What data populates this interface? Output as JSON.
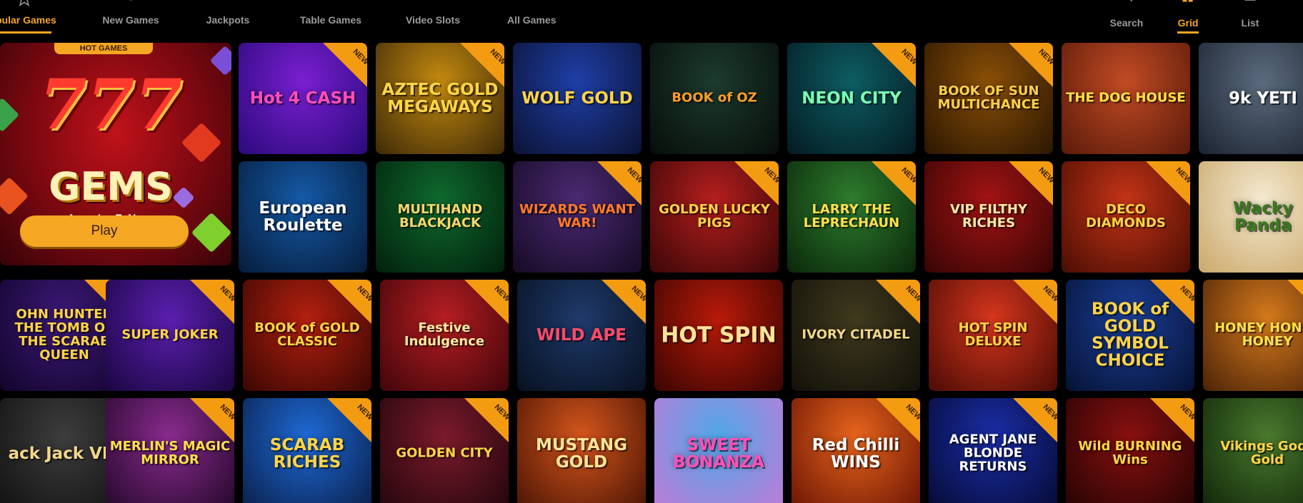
{
  "nav": {
    "tabs": [
      {
        "label": "pular Games",
        "icon": "star-icon",
        "active": true
      },
      {
        "label": "New Games",
        "icon": "chevron-down-icon",
        "active": false
      },
      {
        "label": "Jackpots",
        "icon": "jackpot-icon",
        "active": false
      },
      {
        "label": "Table Games",
        "icon": "cards-icon",
        "active": false
      },
      {
        "label": "Video Slots",
        "icon": "slot-icon",
        "active": false
      },
      {
        "label": "All Games",
        "icon": "grid-icon",
        "active": false
      }
    ],
    "view": {
      "search_label": "Search",
      "grid_label": "Grid",
      "list_label": "List",
      "active": "Grid"
    }
  },
  "hero": {
    "badge": "HOT GAMES",
    "logo_777": "777",
    "logo_gems": "GEMS",
    "subtitle": "· classic 5 lines ·",
    "play_label": "Play"
  },
  "new_badge": "NEW",
  "games": [
    {
      "name": "Hot 4 Cash",
      "new": true
    },
    {
      "name": "Aztec Gold Megaways",
      "new": true
    },
    {
      "name": "Wolf Gold",
      "new": false
    },
    {
      "name": "Book of Oz",
      "new": false
    },
    {
      "name": "Neon City",
      "new": true
    },
    {
      "name": "Book of Sun Multichance",
      "new": true
    },
    {
      "name": "The Dog House",
      "new": false
    },
    {
      "name": "9k Yeti",
      "new": false
    },
    {
      "name": "European Roulette",
      "new": false
    },
    {
      "name": "Multihand Blackjack",
      "new": false
    },
    {
      "name": "Wizards Want War!",
      "new": true
    },
    {
      "name": "Golden Lucky Pigs",
      "new": true
    },
    {
      "name": "Larry the Leprechaun",
      "new": true
    },
    {
      "name": "VIP Filthy Riches",
      "new": true
    },
    {
      "name": "Deco Diamonds",
      "new": true
    },
    {
      "name": "Wacky Panda",
      "new": false
    },
    {
      "name": "John Hunter and the Tomb of the Scarab Queen",
      "new": true
    },
    {
      "name": "Super Joker",
      "new": true
    },
    {
      "name": "Book of Gold Classic",
      "new": true
    },
    {
      "name": "Festive Indulgence",
      "new": true
    },
    {
      "name": "Wild Ape",
      "new": true
    },
    {
      "name": "Hot Spin",
      "new": false
    },
    {
      "name": "Ivory Citadel",
      "new": true
    },
    {
      "name": "Hot Spin Deluxe",
      "new": true
    },
    {
      "name": "Book of Gold Symbol Choice",
      "new": true
    },
    {
      "name": "Honey Honey Honey",
      "new": true
    },
    {
      "name": "Black Jack VIP",
      "new": false
    },
    {
      "name": "Merlin's Magic Mirror",
      "new": true
    },
    {
      "name": "Scarab Riches",
      "new": true
    },
    {
      "name": "Golden City",
      "new": true
    },
    {
      "name": "Mustang Gold",
      "new": false
    },
    {
      "name": "Sweet Bonanza",
      "new": false
    },
    {
      "name": "Red Chilli Wins",
      "new": true
    },
    {
      "name": "Agent Jane Blonde Returns",
      "new": true
    },
    {
      "name": "Wild Burning Wins",
      "new": true
    },
    {
      "name": "Vikings Gods Gold",
      "new": false
    }
  ],
  "tile_titles": [
    "Hot 4 CASH",
    "AZTEC GOLD MEGAWAYS",
    "WOLF GOLD",
    "BOOK of OZ",
    "NEON CITY",
    "BOOK OF SUN MULTICHANCE",
    "THE DOG HOUSE",
    "9k YETI",
    "European Roulette",
    "MULTIHAND BLACKJACK",
    "WIZARDS WANT WAR!",
    "GOLDEN LUCKY PIGS",
    "LARRY THE LEPRECHAUN",
    "VIP FILTHY RICHES",
    "DECO DIAMONDS",
    "Wacky Panda",
    "OHN HUNTER THE TOMB OF THE SCARAB QUEEN",
    "SUPER JOKER",
    "BOOK of GOLD CLASSIC",
    "Festive Indulgence",
    "WILD APE",
    "HOT SPIN",
    "IVORY CITADEL",
    "HOT SPIN DELUXE",
    "BOOK of GOLD SYMBOL CHOICE",
    "HONEY HONEY HONEY",
    "ack Jack VIP",
    "MERLIN'S MAGIC MIRROR",
    "SCARAB RICHES",
    "GOLDEN CITY",
    "MUSTANG GOLD",
    "SWEET BONANZA",
    "Red Chilli WINS",
    "AGENT JANE BLONDE RETURNS",
    "Wild BURNING Wins",
    "Vikings Gods Gold"
  ],
  "colors": {
    "accent": "#f5a623",
    "background": "#000000",
    "nav_inactive": "#9a9a9a",
    "ribbon": "#f39c12"
  }
}
